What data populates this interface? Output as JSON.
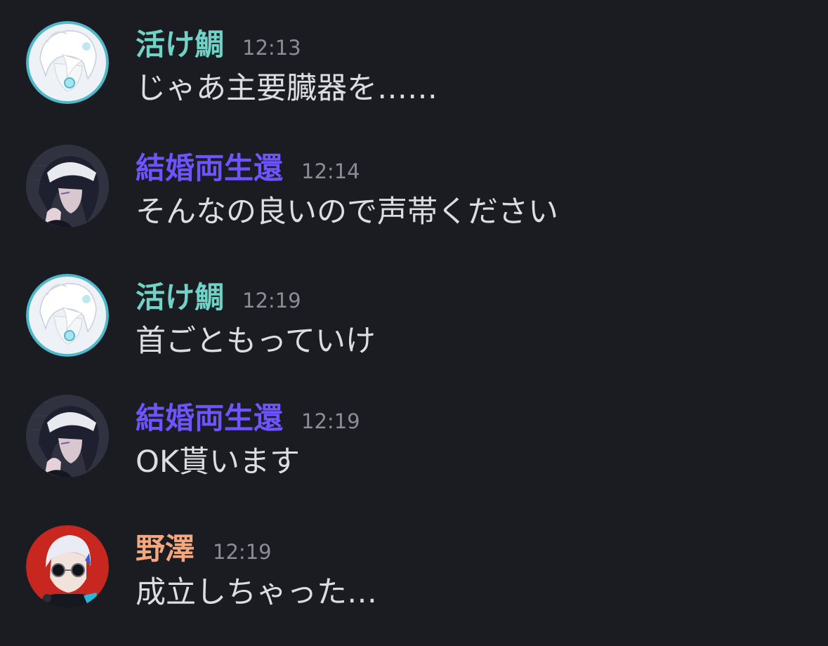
{
  "colors": {
    "background": "#1b1c21",
    "timestamp": "#8b8d95",
    "message_text": "#dcdde1",
    "ikedai": "#6fd3c7",
    "kekkon": "#6e54ff",
    "nozawa": "#f2a77e"
  },
  "messages": [
    {
      "author": "活け鯛",
      "time": "12:13",
      "text": "じゃあ主要臓器を……",
      "name_color": "#6fd3c7",
      "avatar_icon": "white-haired-character-avatar"
    },
    {
      "author": "結婚両生還",
      "time": "12:14",
      "text": "そんなの良いので声帯ください",
      "name_color": "#6e54ff",
      "avatar_icon": "dark-haired-character-avatar"
    },
    {
      "author": "活け鯛",
      "time": "12:19",
      "text": "首ごともっていけ",
      "name_color": "#6fd3c7",
      "avatar_icon": "white-haired-character-avatar"
    },
    {
      "author": "結婚両生還",
      "time": "12:19",
      "text": "OK貰います",
      "name_color": "#6e54ff",
      "avatar_icon": "dark-haired-character-avatar"
    },
    {
      "author": "野澤",
      "time": "12:19",
      "text": "成立しちゃった…",
      "name_color": "#f2a77e",
      "avatar_icon": "sunglasses-character-avatar"
    }
  ]
}
